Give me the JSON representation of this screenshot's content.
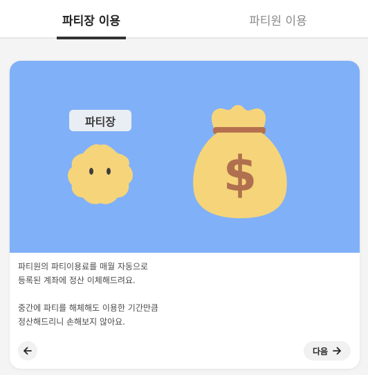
{
  "tabs": [
    {
      "label": "파티장 이용",
      "active": true
    },
    {
      "label": "파티원 이용",
      "active": false
    }
  ],
  "banner": {
    "badge_label": "파티장",
    "background_color": "#80b0f8",
    "icons": [
      "smiley-blob-icon",
      "money-bag-icon"
    ]
  },
  "description": {
    "line1": "파티원의 파티이용료를 매월 자동으로",
    "line2": "등록된 계좌에 정산 이체해드려요.",
    "line3": "중간에 파티를 해체해도 이용한 기간만큼",
    "line4": "정산해드리니 손해보지 않아요."
  },
  "navigation": {
    "prev_icon": "arrow-left-icon",
    "next_label": "다음",
    "next_icon": "arrow-right-icon"
  }
}
